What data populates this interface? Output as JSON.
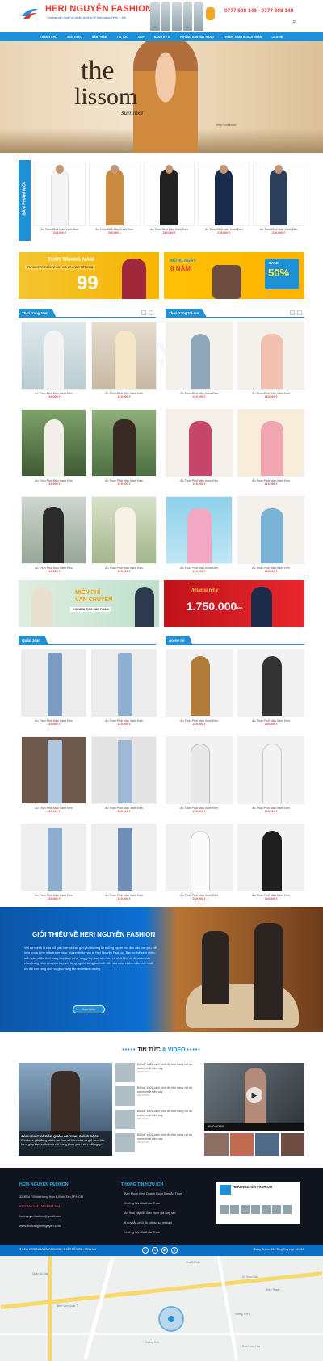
{
  "header": {
    "brand": "HERI NGUYỄN FASHION",
    "slogan": "Xưởng sản xuất và phân phối sỉ lẻ thời trang Teen + Bé",
    "hotline": "0777 608 149 - 0777 608 149",
    "nav": [
      "TRANG CHỦ",
      "GIỚI THIỆU",
      "SẢN PHẨM",
      "TIN TỨC",
      "CLIP",
      "ĐĂNG KÝ SỈ",
      "HƯỚNG DẪN ĐẶT HÀNG",
      "THANH TOÁN & GIAO NHẬN",
      "LIÊN HỆ"
    ]
  },
  "hero": {
    "line1": "the",
    "line2": "lissom",
    "line3": "summer",
    "tag": "new lookbook"
  },
  "new_products": {
    "label": "SẢN PHẨM MỚI",
    "items": [
      {
        "name": "Áo Thun Phối Màu Xanh Đen",
        "price": "219.000 ₫"
      },
      {
        "name": "Áo Thun Phối Màu Xanh Đen",
        "price": "219.000 ₫"
      },
      {
        "name": "Áo Thun Phối Màu Xanh Đen",
        "price": "219.000 ₫"
      },
      {
        "name": "Áo Thun Phối Màu Xanh Đen",
        "price": "219.000 ₫"
      },
      {
        "name": "Áo Thun Phối Màu Xanh Đen",
        "price": "219.000 ₫"
      }
    ]
  },
  "banner1": {
    "title": "THỜI TRANG NAM",
    "sub": "CHUẨN STYLE ĐẦU XUÂN - GIÁ VÔ CÙNG TIẾT KIỆM",
    "price": "99"
  },
  "banner2": {
    "l1": "MỪNG NGÀY",
    "l2": "8 NĂM",
    "sale": "SALE",
    "pct": "50%"
  },
  "sec_women": {
    "title": "Thời trang teen"
  },
  "sec_kids": {
    "title": "Thời trang trẻ em"
  },
  "sec_jeans": {
    "title": "Quần Jean"
  },
  "sec_shirts": {
    "title": "Áo sơ mi"
  },
  "product_name": "Áo Thun Phối Màu Xanh Đen",
  "product_price": "219.000 ₫",
  "banner3": {
    "l1": "MIỄN PHÍ",
    "l2": "VẬN CHUYỂN",
    "l3": "KHI MUA TỪ 2 SẢN PHẨM"
  },
  "banner4": {
    "script": "Mua sỉ tết ý",
    "amount": "1.750.000",
    "unit": "VNĐ"
  },
  "about": {
    "title": "GIỚI THIỆU VỀ HERI NGUYỄN FASHION",
    "text": "Với sứ mệnh là cầu nối gần hơn và trao gửi yêu thương từ những người thợ đến các con yêu thể hiện trong từng mẫu trang phục, chúng tôi tự hào là Heri Nguyễn Fashion. Bạn có thể xem nhiều mẫu sản phẩm thời trang đẹp theo mùa, ưng ý tùy theo nhu cầu và chất liệu, và được tư vấn chọn trang phục cho phù hợp với từng người, từng lứa tuổi. Hãy lựa chọn nhiều mẫu mới nhất, ưu đãi cao cùng dịch vụ giao hàng tận nơi nhanh chóng.",
    "button": "Xem thêm"
  },
  "news": {
    "title_a": "TIN TỨC",
    "title_b": "& VIDEO",
    "dots": "•••••",
    "main_title": "CÁCH GIẶT VÀ BẢO QUẢN ÁO THUN ĐÚNG CÁCH",
    "main_desc": "Khi được giặt đúng cách, áo thun sẽ bền màu và giữ form lâu hơn, giúp bạn tự tin hơn với trang phục yêu thích mỗi ngày.",
    "items": [
      {
        "t": "Bỏ túi\" 1001 cách phối đồ thời trang với áo sơ mi nhất hiện nay",
        "d": "25/10/2019"
      },
      {
        "t": "Bỏ túi\" 1001 cách phối đồ thời trang với áo sơ mi nhất hiện nay",
        "d": "25/10/2019"
      },
      {
        "t": "Bỏ túi\" 1001 cách phối đồ thời trang với áo sơ mi nhất hiện nay",
        "d": "25/10/2019"
      },
      {
        "t": "Bỏ túi\" 1001 cách phối đồ thời trang với áo sơ mi nhất hiện nay",
        "d": "25/10/2019"
      }
    ],
    "video_time": "00:00 / 03:00"
  },
  "footer": {
    "brand": "HERI NGUYỄN FASHION",
    "address": "32/4E/4 P.Bình Hưng Hòa B,Bình Tân,TP.HCM",
    "phone": "0777 608 149 - 0913 683 894",
    "email": "heringuyenfashion@gmail.com",
    "web": "www.thoitrangheringuyen.com",
    "useful": "THÔNG TIN HỮU ÍCH",
    "links": [
      "Bạn Muốn Kinh Doanh Buôn Bán Áo Thun",
      "Xưởng Sản Xuất Áo Thun",
      "Áo thun cặp đôi tình nhân giá hợp tạo",
      "8 quy tắc phối đồ với áo sơ mi kaki",
      "Xưởng Sản Xuất Áo Thun"
    ],
    "fb_name": "HERI NGUYỄN FASHION",
    "copyright": "© 2019 HERI NGUYỄN FASHION - THIẾT KẾ WEB - VINA.VN",
    "online": "Đang Online: 15  |  Tổng Truy cập: 50.234"
  },
  "map": {
    "labels": [
      "Chợ Gò Vấp",
      "Quận Gò Vấp",
      "Gò Xoài Cửa",
      "Bệnh Viện Quận 7",
      "Trường THPT",
      "Hiệp Thành",
      "Xưởng Heri",
      "Bình Hưng Hòa"
    ]
  },
  "colors": {
    "primary": "#1e90d6",
    "price": "#e53935",
    "footer": "#10141f"
  }
}
